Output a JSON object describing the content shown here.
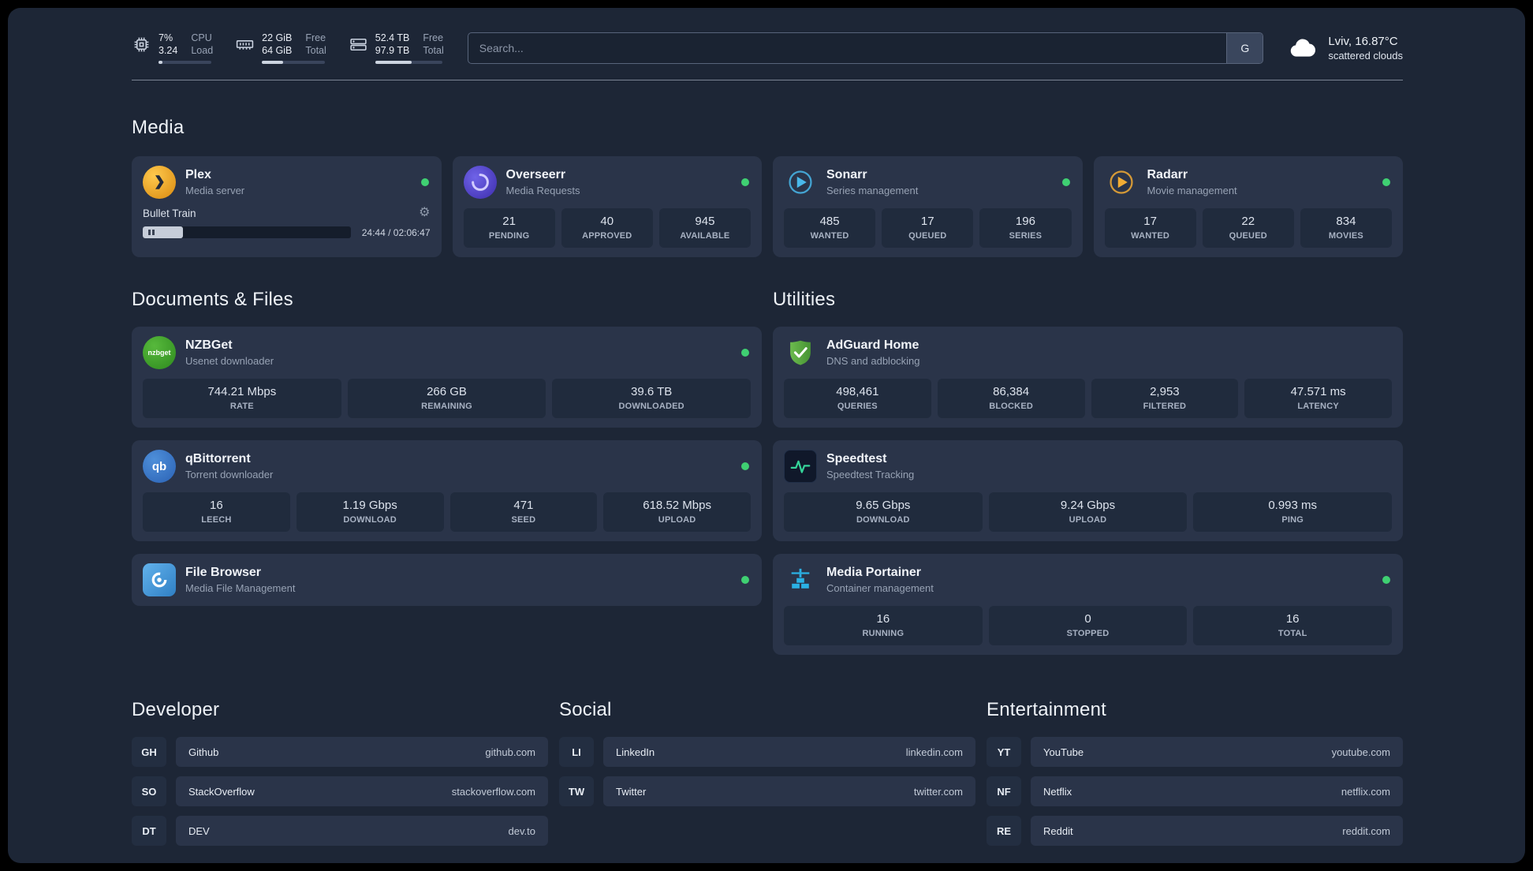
{
  "colors": {
    "background": "#1d2636",
    "card": "#2a3449",
    "stat_tile": "#202b3d",
    "status_online": "#3fd072",
    "plex_accent": "#e9a51b",
    "sonarr_accent": "#49b8ea",
    "radarr_accent": "#f2ac34",
    "adguard_accent": "#57a845",
    "portainer_accent": "#2bb1e4"
  },
  "icons": {
    "gear": "⚙"
  },
  "topbar": {
    "cpu": {
      "line1": "7%",
      "line2": "3.24",
      "label1": "CPU",
      "label2": "Load",
      "progress": 7
    },
    "ram": {
      "line1": "22 GiB",
      "line2": "64 GiB",
      "label1": "Free",
      "label2": "Total",
      "progress": 34
    },
    "disk": {
      "line1": "52.4 TB",
      "line2": "97.9 TB",
      "label1": "Free",
      "label2": "Total",
      "progress": 54
    },
    "search": {
      "placeholder": "Search...",
      "engine_button": "G"
    },
    "weather": {
      "location": "Lviv, 16.87°C",
      "condition": "scattered clouds"
    }
  },
  "sections": {
    "media": "Media",
    "documents": "Documents & Files",
    "utilities": "Utilities",
    "developer": "Developer",
    "social": "Social",
    "entertainment": "Entertainment"
  },
  "apps": {
    "plex": {
      "name": "Plex",
      "subtitle": "Media server",
      "now_playing": {
        "title": "Bullet Train",
        "time": "24:44 / 02:06:47",
        "progress": 19.5
      }
    },
    "overseerr": {
      "name": "Overseerr",
      "subtitle": "Media Requests",
      "stats": [
        {
          "value": "21",
          "label": "PENDING"
        },
        {
          "value": "40",
          "label": "APPROVED"
        },
        {
          "value": "945",
          "label": "AVAILABLE"
        }
      ]
    },
    "sonarr": {
      "name": "Sonarr",
      "subtitle": "Series management",
      "stats": [
        {
          "value": "485",
          "label": "WANTED"
        },
        {
          "value": "17",
          "label": "QUEUED"
        },
        {
          "value": "196",
          "label": "SERIES"
        }
      ]
    },
    "radarr": {
      "name": "Radarr",
      "subtitle": "Movie management",
      "stats": [
        {
          "value": "17",
          "label": "WANTED"
        },
        {
          "value": "22",
          "label": "QUEUED"
        },
        {
          "value": "834",
          "label": "MOVIES"
        }
      ]
    },
    "nzbget": {
      "name": "NZBGet",
      "subtitle": "Usenet downloader",
      "icon_text": "nzbget",
      "stats": [
        {
          "value": "744.21 Mbps",
          "label": "RATE"
        },
        {
          "value": "266 GB",
          "label": "REMAINING"
        },
        {
          "value": "39.6 TB",
          "label": "DOWNLOADED"
        }
      ]
    },
    "qbittorrent": {
      "name": "qBittorrent",
      "subtitle": "Torrent downloader",
      "icon_text": "qb",
      "stats": [
        {
          "value": "16",
          "label": "LEECH"
        },
        {
          "value": "1.19 Gbps",
          "label": "DOWNLOAD"
        },
        {
          "value": "471",
          "label": "SEED"
        },
        {
          "value": "618.52 Mbps",
          "label": "UPLOAD"
        }
      ]
    },
    "filebrowser": {
      "name": "File Browser",
      "subtitle": "Media File Management"
    },
    "adguard": {
      "name": "AdGuard Home",
      "subtitle": "DNS and adblocking",
      "stats": [
        {
          "value": "498,461",
          "label": "QUERIES"
        },
        {
          "value": "86,384",
          "label": "BLOCKED"
        },
        {
          "value": "2,953",
          "label": "FILTERED"
        },
        {
          "value": "47.571 ms",
          "label": "LATENCY"
        }
      ]
    },
    "speedtest": {
      "name": "Speedtest",
      "subtitle": "Speedtest Tracking",
      "stats": [
        {
          "value": "9.65 Gbps",
          "label": "DOWNLOAD"
        },
        {
          "value": "9.24 Gbps",
          "label": "UPLOAD"
        },
        {
          "value": "0.993 ms",
          "label": "PING"
        }
      ]
    },
    "portainer": {
      "name": "Media Portainer",
      "subtitle": "Container management",
      "stats": [
        {
          "value": "16",
          "label": "RUNNING"
        },
        {
          "value": "0",
          "label": "STOPPED"
        },
        {
          "value": "16",
          "label": "TOTAL"
        }
      ]
    }
  },
  "bookmarks": {
    "developer": [
      {
        "abbr": "GH",
        "name": "Github",
        "url": "github.com"
      },
      {
        "abbr": "SO",
        "name": "StackOverflow",
        "url": "stackoverflow.com"
      },
      {
        "abbr": "DT",
        "name": "DEV",
        "url": "dev.to"
      }
    ],
    "social": [
      {
        "abbr": "LI",
        "name": "LinkedIn",
        "url": "linkedin.com"
      },
      {
        "abbr": "TW",
        "name": "Twitter",
        "url": "twitter.com"
      }
    ],
    "entertainment": [
      {
        "abbr": "YT",
        "name": "YouTube",
        "url": "youtube.com"
      },
      {
        "abbr": "NF",
        "name": "Netflix",
        "url": "netflix.com"
      },
      {
        "abbr": "RE",
        "name": "Reddit",
        "url": "reddit.com"
      }
    ]
  }
}
